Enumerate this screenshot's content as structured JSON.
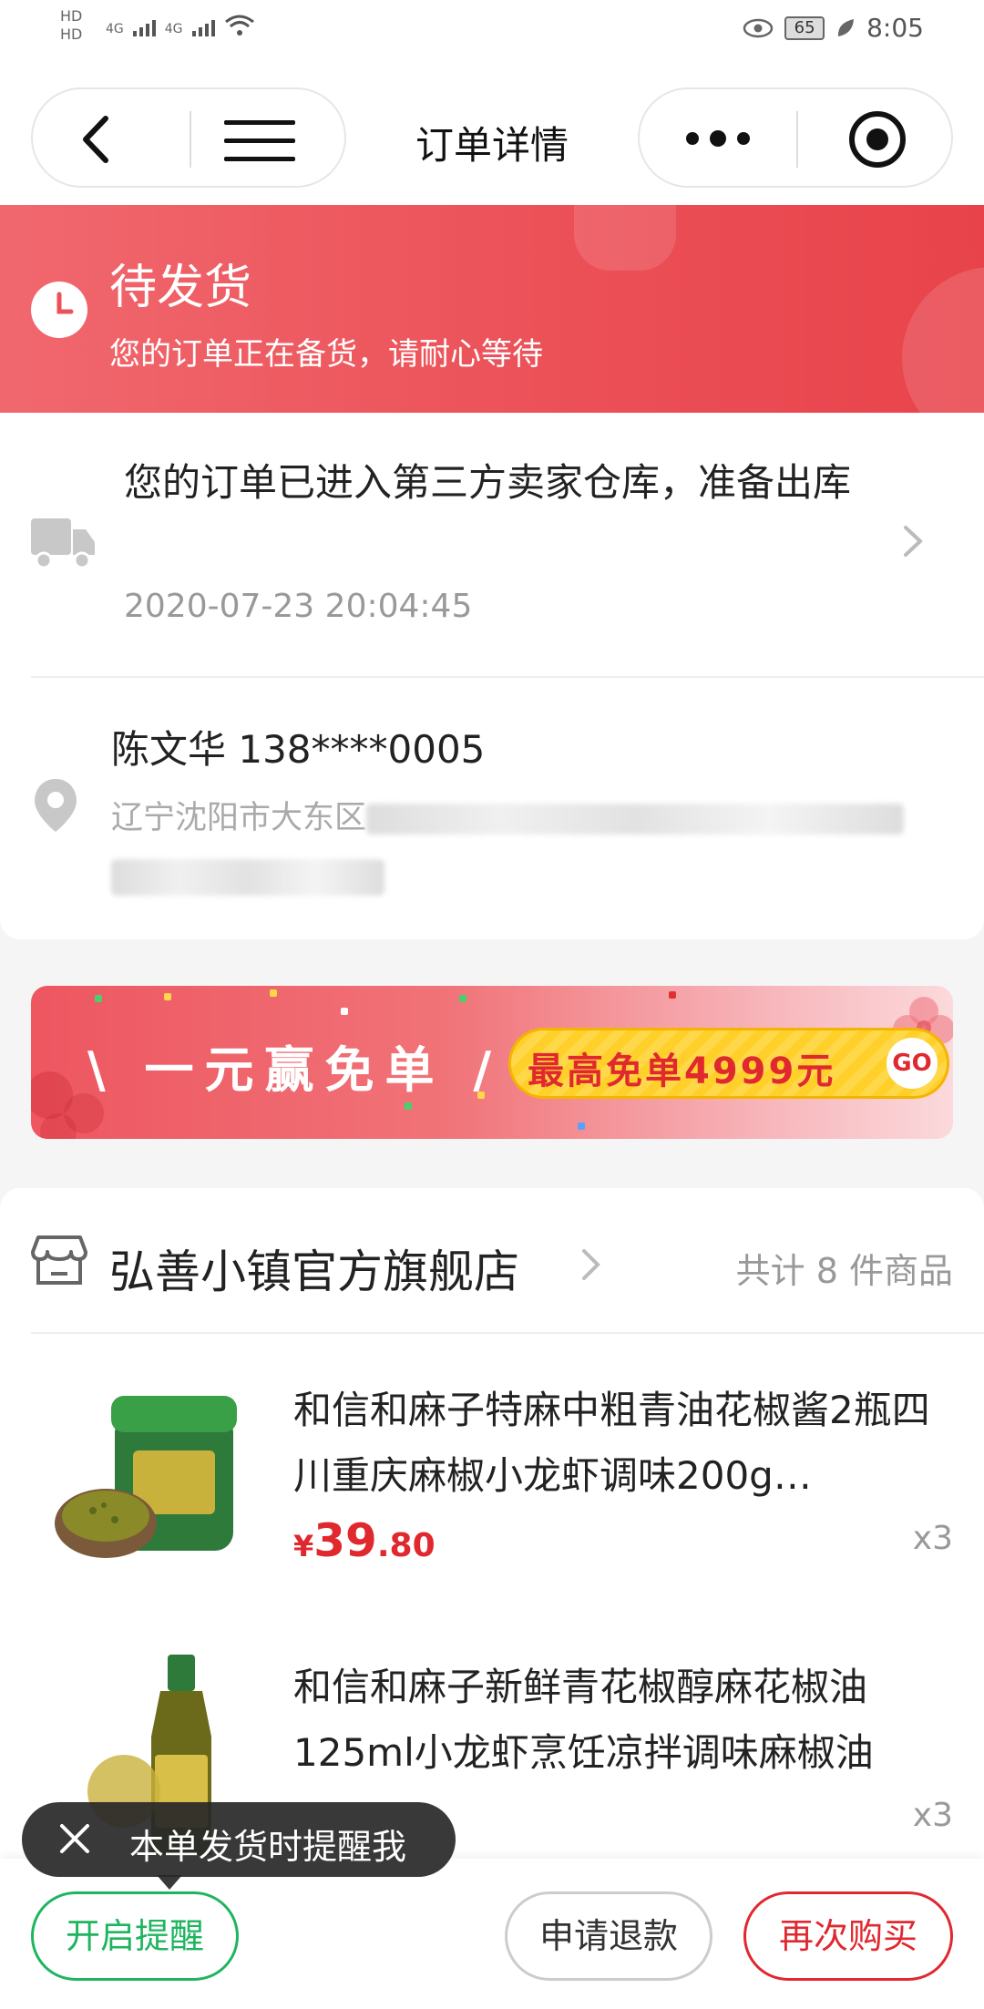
{
  "status_bar": {
    "hd1": "HD",
    "hd2": "HD",
    "sig1": "4G",
    "sig2": "4G",
    "battery": "65",
    "time": "8:05"
  },
  "nav": {
    "title": "订单详情",
    "back_icon": "chevron-left-icon",
    "menu_icon": "hamburger-menu-icon",
    "more_icon": "more-dots-icon",
    "target_icon": "record-target-icon"
  },
  "order_status": {
    "title": "待发货",
    "subtitle": "您的订单正在备货，请耐心等待",
    "icon": "clock-icon",
    "bg_color": "#ec5158"
  },
  "logistics": {
    "text": "您的订单已进入第三方卖家仓库，准备出库",
    "time": "2020-07-23 20:04:45",
    "icon": "truck-icon"
  },
  "address": {
    "name_phone": "陈文华 138****0005",
    "line1_visible": "辽宁沈阳市大东区",
    "icon": "location-pin-icon"
  },
  "promo": {
    "left_text": "\\ 一元赢免单 /",
    "button_text": "最高免单4999元",
    "go_label": "GO"
  },
  "shop": {
    "name": "弘善小镇官方旗舰店",
    "count_text": "共计 8 件商品",
    "icon": "store-icon"
  },
  "products": [
    {
      "title": "和信和麻子特麻中粗青油花椒酱2瓶四川重庆麻椒小龙虾调味200g…",
      "price_currency": "¥",
      "price_int": "39",
      "price_dec": ".80",
      "qty": "x3"
    },
    {
      "title": "和信和麻子新鲜青花椒醇麻花椒油125ml小龙虾烹饪凉拌调味麻椒油",
      "qty": "x3"
    }
  ],
  "tooltip": {
    "text": "本单发货时提醒我",
    "close_icon": "close-icon"
  },
  "bottom": {
    "remind": "开启提醒",
    "refund": "申请退款",
    "rebuy": "再次购买",
    "accent_green": "#1fb55f",
    "accent_red": "#e0282f"
  }
}
